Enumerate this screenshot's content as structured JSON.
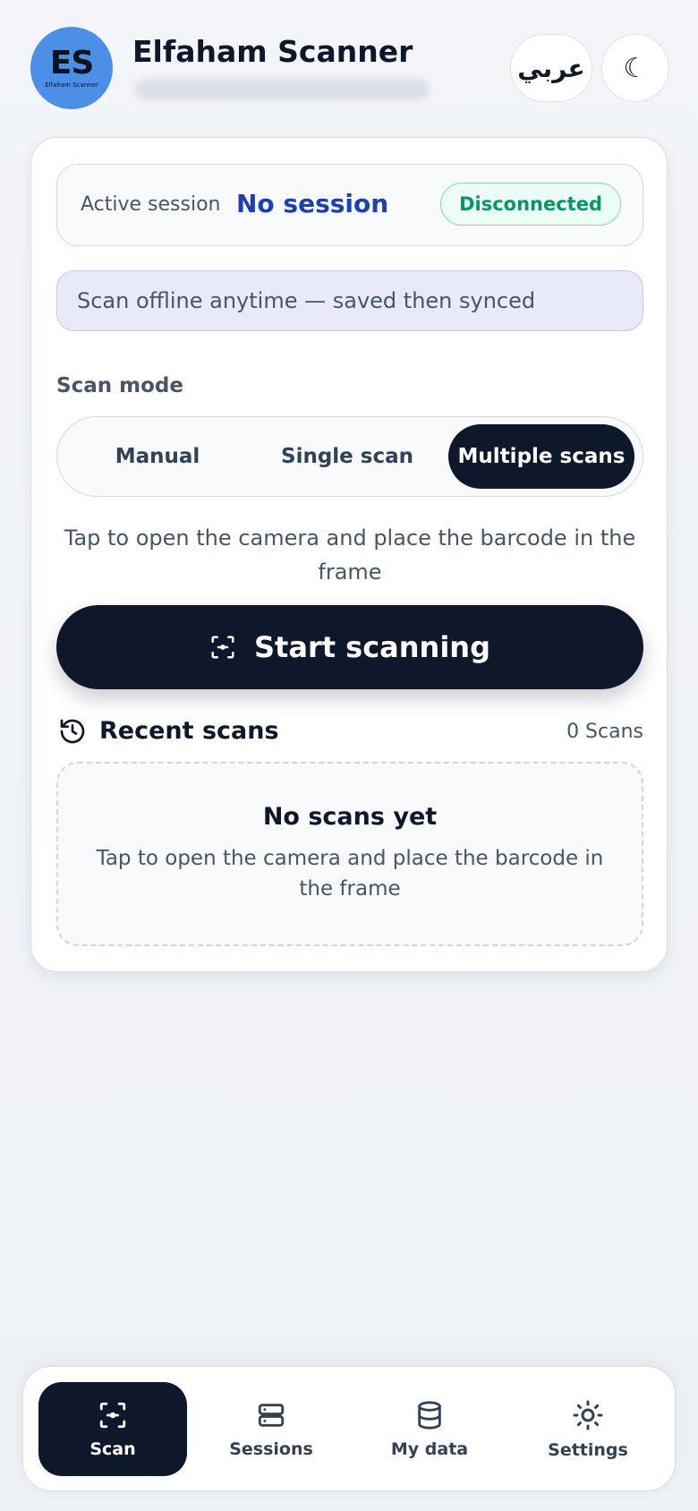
{
  "header": {
    "logo_letters": "ES",
    "logo_subtitle": "Elfaham Scanner",
    "title": "Elfaham Scanner",
    "language_button": "عربي",
    "theme_button": "☾"
  },
  "session": {
    "label": "Active session",
    "value": "No session",
    "status": "Disconnected"
  },
  "offline_notice": "Scan offline anytime — saved then synced",
  "scan_mode": {
    "label": "Scan mode",
    "options": [
      "Manual",
      "Single scan",
      "Multiple scans"
    ],
    "selected": "Multiple scans"
  },
  "hint": "Tap to open the camera and place the barcode in the frame",
  "start_button": "Start scanning",
  "recent": {
    "title": "Recent scans",
    "count": "0 Scans",
    "empty_title": "No scans yet",
    "empty_text": "Tap to open the camera and place the barcode in the frame"
  },
  "nav": {
    "items": [
      {
        "label": "Scan",
        "icon": "scan-icon",
        "active": true
      },
      {
        "label": "Sessions",
        "icon": "sessions-icon"
      },
      {
        "label": "My data",
        "icon": "database-icon"
      },
      {
        "label": "Settings",
        "icon": "gear-icon"
      }
    ]
  },
  "colors": {
    "primary": "#0f172a",
    "accent_blue": "#1e40af",
    "success": "#059669",
    "logo_bg": "#4b8fe6"
  }
}
